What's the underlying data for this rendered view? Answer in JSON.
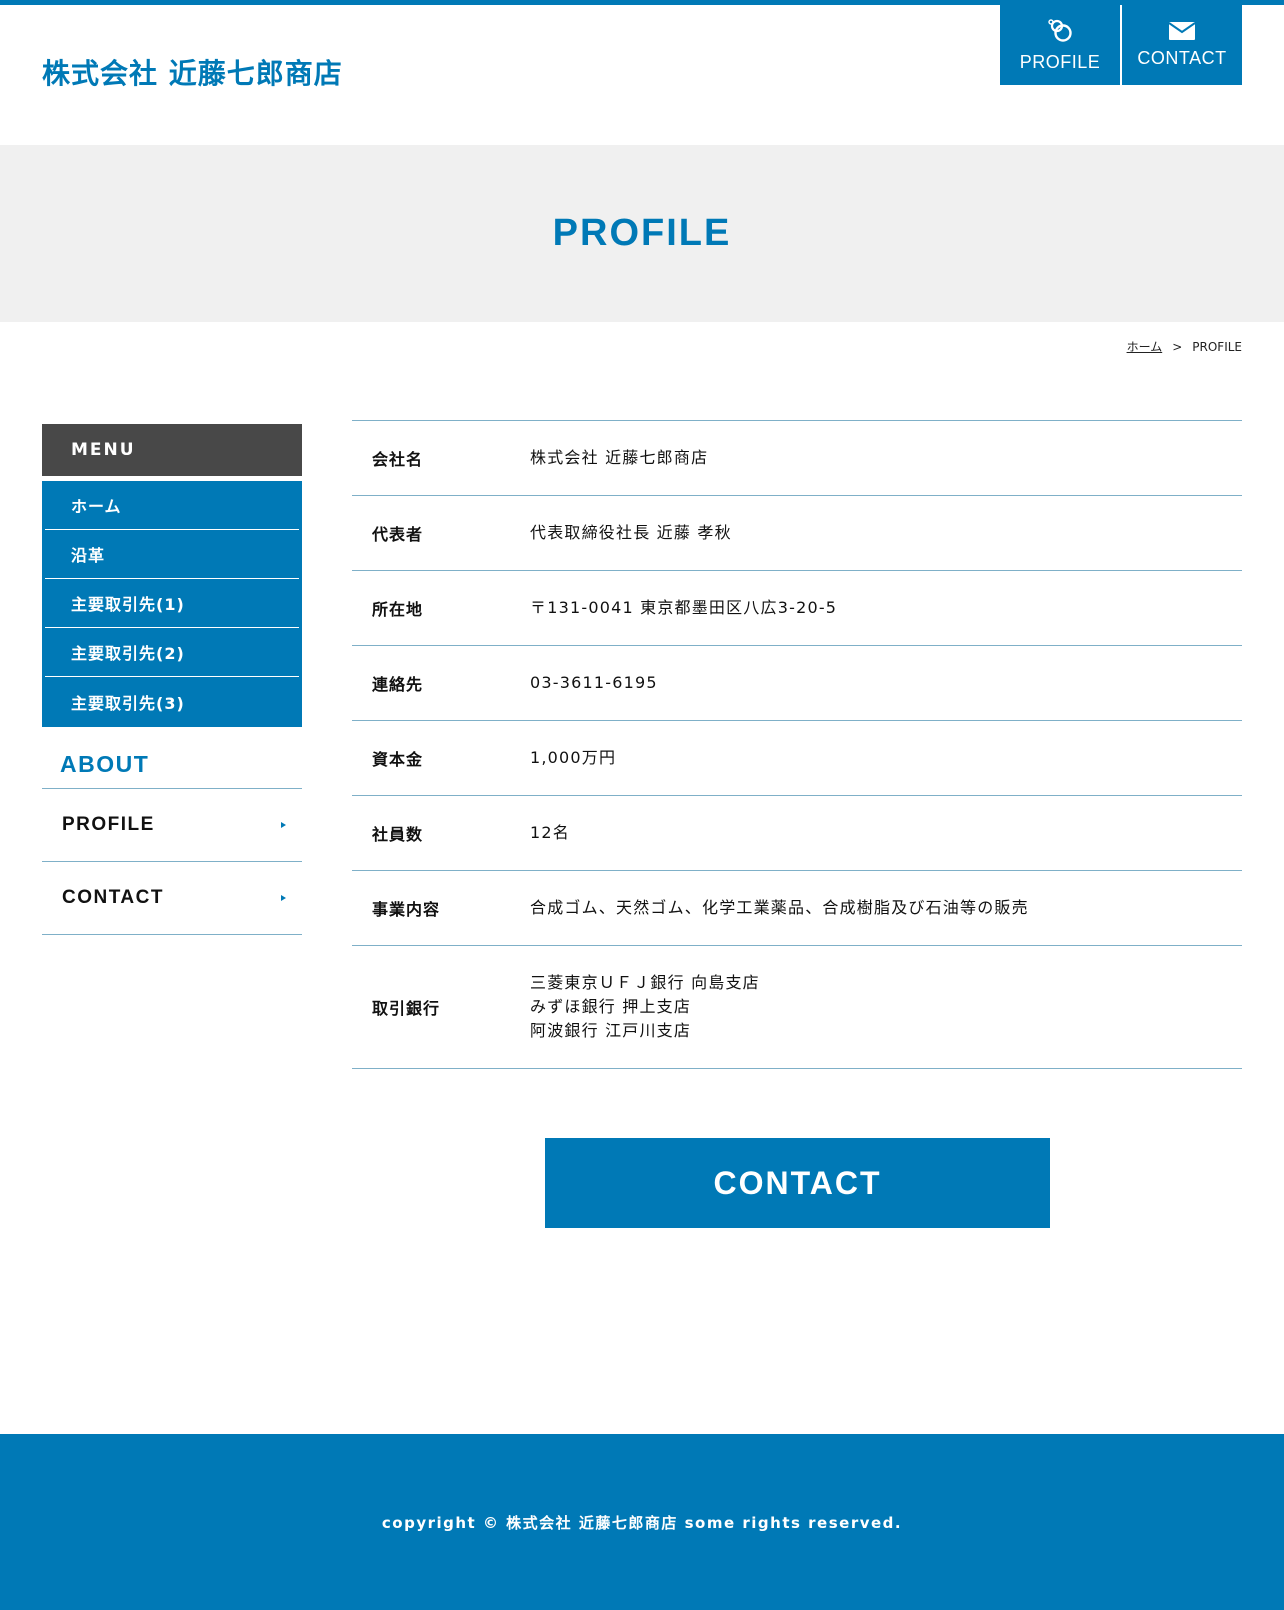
{
  "site": {
    "logo": "株式会社 近藤七郎商店"
  },
  "header_nav": [
    {
      "label": "PROFILE",
      "icon": "rings-icon"
    },
    {
      "label": "CONTACT",
      "icon": "mail-icon"
    }
  ],
  "hero": {
    "title": "PROFILE"
  },
  "breadcrumb": {
    "home": "ホーム",
    "separator": ">",
    "current": "PROFILE"
  },
  "sidebar": {
    "menu_title": "MENU",
    "menu_items": [
      "ホーム",
      "沿革",
      "主要取引先(1)",
      "主要取引先(2)",
      "主要取引先(3)"
    ],
    "about_title": "ABOUT",
    "about_items": [
      "PROFILE",
      "CONTACT"
    ]
  },
  "profile": [
    {
      "label": "会社名",
      "value": "株式会社 近藤七郎商店"
    },
    {
      "label": "代表者",
      "value": "代表取締役社長 近藤 孝秋"
    },
    {
      "label": "所在地",
      "value": "〒131-0041 東京都墨田区八広3-20-5"
    },
    {
      "label": "連絡先",
      "value": "03-3611-6195"
    },
    {
      "label": "資本金",
      "value": "1,000万円"
    },
    {
      "label": "社員数",
      "value": "12名"
    },
    {
      "label": "事業内容",
      "value": "合成ゴム、天然ゴム、化学工業薬品、合成樹脂及び石油等の販売"
    },
    {
      "label": "取引銀行",
      "lines": [
        "三菱東京ＵＦＪ銀行 向島支店",
        "みずほ銀行 押上支店",
        "阿波銀行 江戸川支店"
      ]
    }
  ],
  "cta": {
    "label": "CONTACT"
  },
  "footer": {
    "copyright": "copyright © 株式会社 近藤七郎商店 some rights reserved."
  },
  "colors": {
    "accent": "#0079b6",
    "menu_header": "#484848",
    "hero_bg": "#f0f0f0"
  }
}
